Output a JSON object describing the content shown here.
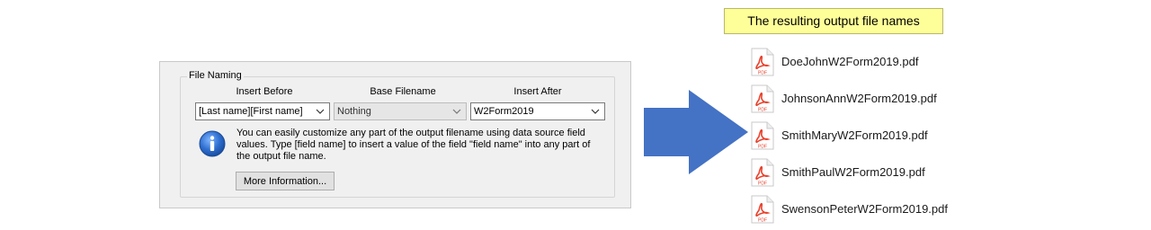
{
  "dialog": {
    "group_title": "File Naming",
    "columns": {
      "insert_before": {
        "header": "Insert Before",
        "value": "[Last name][First name]"
      },
      "base_filename": {
        "header": "Base Filename",
        "value": "Nothing"
      },
      "insert_after": {
        "header": "Insert After",
        "value": "W2Form2019"
      }
    },
    "info_text": "You can easily customize any part of the output filename using data source field values. Type [field name] to insert a value of the field \"field name\" into any part of the output file name.",
    "more_button_label": "More Information...",
    "icons": {
      "info": "info-icon",
      "dropdown": "chevron-down-icon"
    }
  },
  "arrow": {
    "color": "#4472c4",
    "icon": "right-arrow-icon"
  },
  "callout": {
    "text": "The resulting output file names",
    "background": "#ffff99"
  },
  "files": [
    {
      "name": "DoeJohnW2Form2019.pdf",
      "icon": "pdf-icon",
      "badge": "PDF"
    },
    {
      "name": "JohnsonAnnW2Form2019.pdf",
      "icon": "pdf-icon",
      "badge": "PDF"
    },
    {
      "name": "SmithMaryW2Form2019.pdf",
      "icon": "pdf-icon",
      "badge": "PDF"
    },
    {
      "name": "SmithPaulW2Form2019.pdf",
      "icon": "pdf-icon",
      "badge": "PDF"
    },
    {
      "name": "SwensonPeterW2Form2019.pdf",
      "icon": "pdf-icon",
      "badge": "PDF"
    }
  ],
  "colors": {
    "pdf_red": "#e8412c",
    "accent_blue": "#4472c4"
  }
}
